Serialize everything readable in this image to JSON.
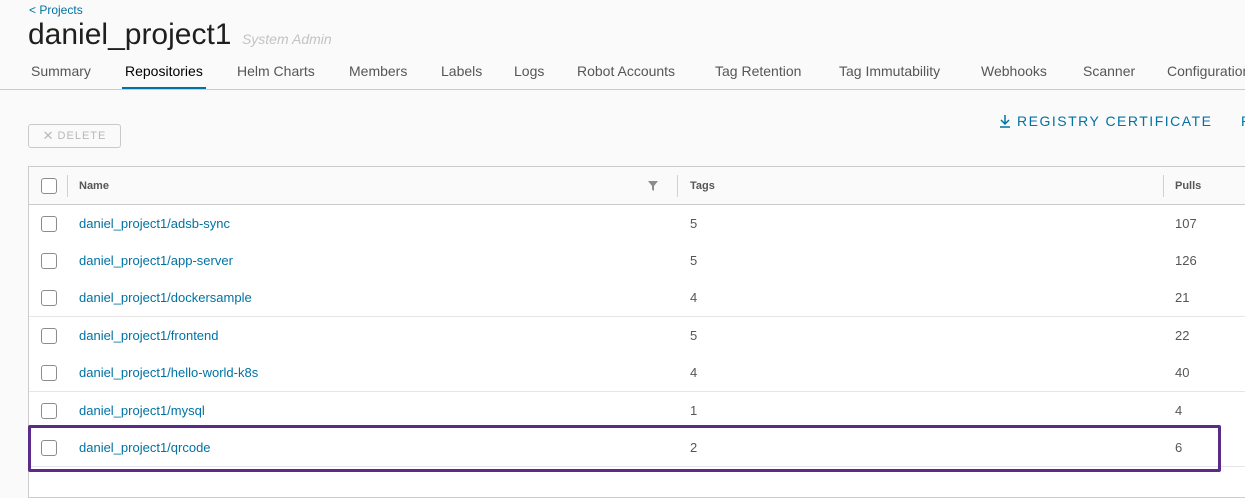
{
  "header": {
    "back_link": "< Projects",
    "title": "daniel_project1",
    "role": "System Admin"
  },
  "tabs": [
    {
      "label": "Summary",
      "active": false
    },
    {
      "label": "Repositories",
      "active": true
    },
    {
      "label": "Helm Charts",
      "active": false
    },
    {
      "label": "Members",
      "active": false
    },
    {
      "label": "Labels",
      "active": false
    },
    {
      "label": "Logs",
      "active": false
    },
    {
      "label": "Robot Accounts",
      "active": false
    },
    {
      "label": "Tag Retention",
      "active": false
    },
    {
      "label": "Tag Immutability",
      "active": false
    },
    {
      "label": "Webhooks",
      "active": false
    },
    {
      "label": "Scanner",
      "active": false
    },
    {
      "label": "Configuration",
      "active": false
    }
  ],
  "toolbar": {
    "delete_label": "DELETE",
    "registry_label": "REGISTRY CERTIFICATE",
    "extra_label": "P"
  },
  "table": {
    "columns": {
      "name": "Name",
      "tags": "Tags",
      "pulls": "Pulls"
    },
    "rows": [
      {
        "name": "daniel_project1/adsb-sync",
        "tags": "5",
        "pulls": "107"
      },
      {
        "name": "daniel_project1/app-server",
        "tags": "5",
        "pulls": "126"
      },
      {
        "name": "daniel_project1/dockersample",
        "tags": "4",
        "pulls": "21"
      },
      {
        "name": "daniel_project1/frontend",
        "tags": "5",
        "pulls": "22"
      },
      {
        "name": "daniel_project1/hello-world-k8s",
        "tags": "4",
        "pulls": "40"
      },
      {
        "name": "daniel_project1/mysql",
        "tags": "1",
        "pulls": "4"
      },
      {
        "name": "daniel_project1/qrcode",
        "tags": "2",
        "pulls": "6"
      }
    ]
  },
  "colors": {
    "link": "#0072a3",
    "highlight": "#5b2b8a"
  }
}
